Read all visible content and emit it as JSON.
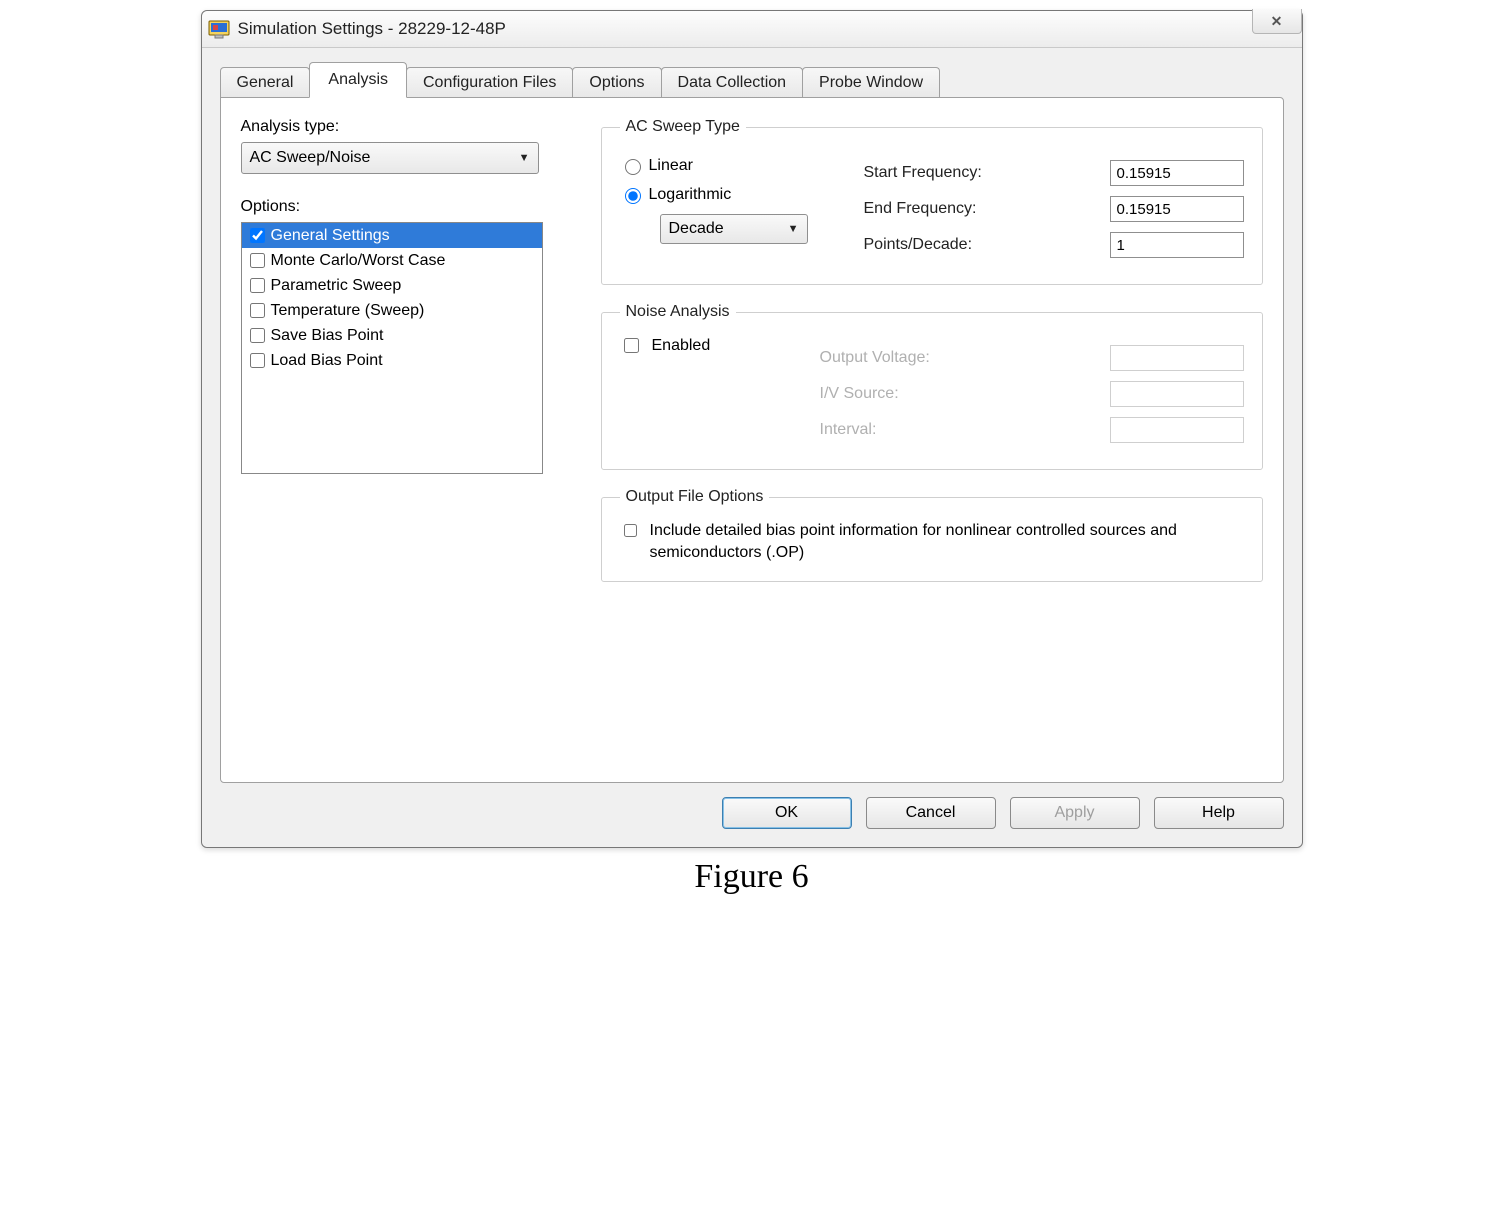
{
  "window": {
    "title": "Simulation Settings - 28229-12-48P"
  },
  "tabs": {
    "items": [
      "General",
      "Analysis",
      "Configuration Files",
      "Options",
      "Data Collection",
      "Probe Window"
    ],
    "active_index": 1
  },
  "analysis": {
    "type_label": "Analysis type:",
    "type_value": "AC Sweep/Noise",
    "options_label": "Options:",
    "options": [
      {
        "label": "General Settings",
        "checked": true,
        "selected": true
      },
      {
        "label": "Monte Carlo/Worst Case",
        "checked": false,
        "selected": false
      },
      {
        "label": "Parametric Sweep",
        "checked": false,
        "selected": false
      },
      {
        "label": "Temperature (Sweep)",
        "checked": false,
        "selected": false
      },
      {
        "label": "Save Bias Point",
        "checked": false,
        "selected": false
      },
      {
        "label": "Load Bias Point",
        "checked": false,
        "selected": false
      }
    ]
  },
  "ac_sweep": {
    "legend": "AC Sweep Type",
    "linear_label": "Linear",
    "log_label": "Logarithmic",
    "selected": "Logarithmic",
    "scale_value": "Decade",
    "start_label": "Start Frequency:",
    "start_value": "0.15915",
    "end_label": "End Frequency:",
    "end_value": "0.15915",
    "points_label": "Points/Decade:",
    "points_value": "1"
  },
  "noise": {
    "legend": "Noise Analysis",
    "enabled_label": "Enabled",
    "enabled": false,
    "output_voltage_label": "Output Voltage:",
    "output_voltage_value": "",
    "iv_source_label": "I/V Source:",
    "iv_source_value": "",
    "interval_label": "Interval:",
    "interval_value": ""
  },
  "output_file": {
    "legend": "Output File Options",
    "detail_label": "Include detailed bias point information for nonlinear controlled sources and semiconductors (.OP)",
    "detail_checked": false
  },
  "buttons": {
    "ok": "OK",
    "cancel": "Cancel",
    "apply": "Apply",
    "help": "Help"
  },
  "caption": "Figure 6"
}
